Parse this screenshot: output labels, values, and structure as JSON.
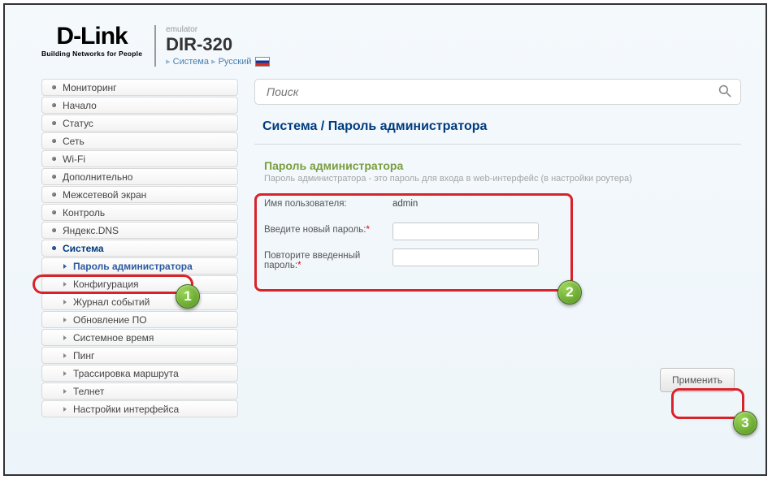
{
  "header": {
    "logo_main": "D-Link",
    "logo_sub": "Building Networks for People",
    "emulator": "emulator",
    "model": "DIR-320",
    "bc_section": "Система",
    "bc_lang": "Русский"
  },
  "sidebar": {
    "items": [
      {
        "label": "Мониторинг"
      },
      {
        "label": "Начало"
      },
      {
        "label": "Статус"
      },
      {
        "label": "Сеть"
      },
      {
        "label": "Wi-Fi"
      },
      {
        "label": "Дополнительно"
      },
      {
        "label": "Межсетевой экран"
      },
      {
        "label": "Контроль"
      },
      {
        "label": "Яндекс.DNS"
      },
      {
        "label": "Система"
      }
    ],
    "sub_items": [
      {
        "label": "Пароль администратора"
      },
      {
        "label": "Конфигурация"
      },
      {
        "label": "Журнал событий"
      },
      {
        "label": "Обновление ПО"
      },
      {
        "label": "Системное время"
      },
      {
        "label": "Пинг"
      },
      {
        "label": "Трассировка маршрута"
      },
      {
        "label": "Телнет"
      },
      {
        "label": "Настройки интерфейса"
      }
    ]
  },
  "search": {
    "placeholder": "Поиск"
  },
  "breadcrumb": {
    "part1": "Система",
    "sep": " / ",
    "part2": "Пароль администратора"
  },
  "section": {
    "title": "Пароль администратора",
    "desc": "Пароль администратора - это пароль для входа в web-интерфейс (в настройки роутера)"
  },
  "form": {
    "username_label": "Имя пользователя:",
    "username_value": "admin",
    "newpass_label": "Введите новый пароль:",
    "confirm_label": "Повторите введенный пароль:",
    "required_mark": "*",
    "newpass_value": "",
    "confirm_value": ""
  },
  "buttons": {
    "apply": "Применить"
  },
  "annotations": {
    "b1": "1",
    "b2": "2",
    "b3": "3"
  }
}
